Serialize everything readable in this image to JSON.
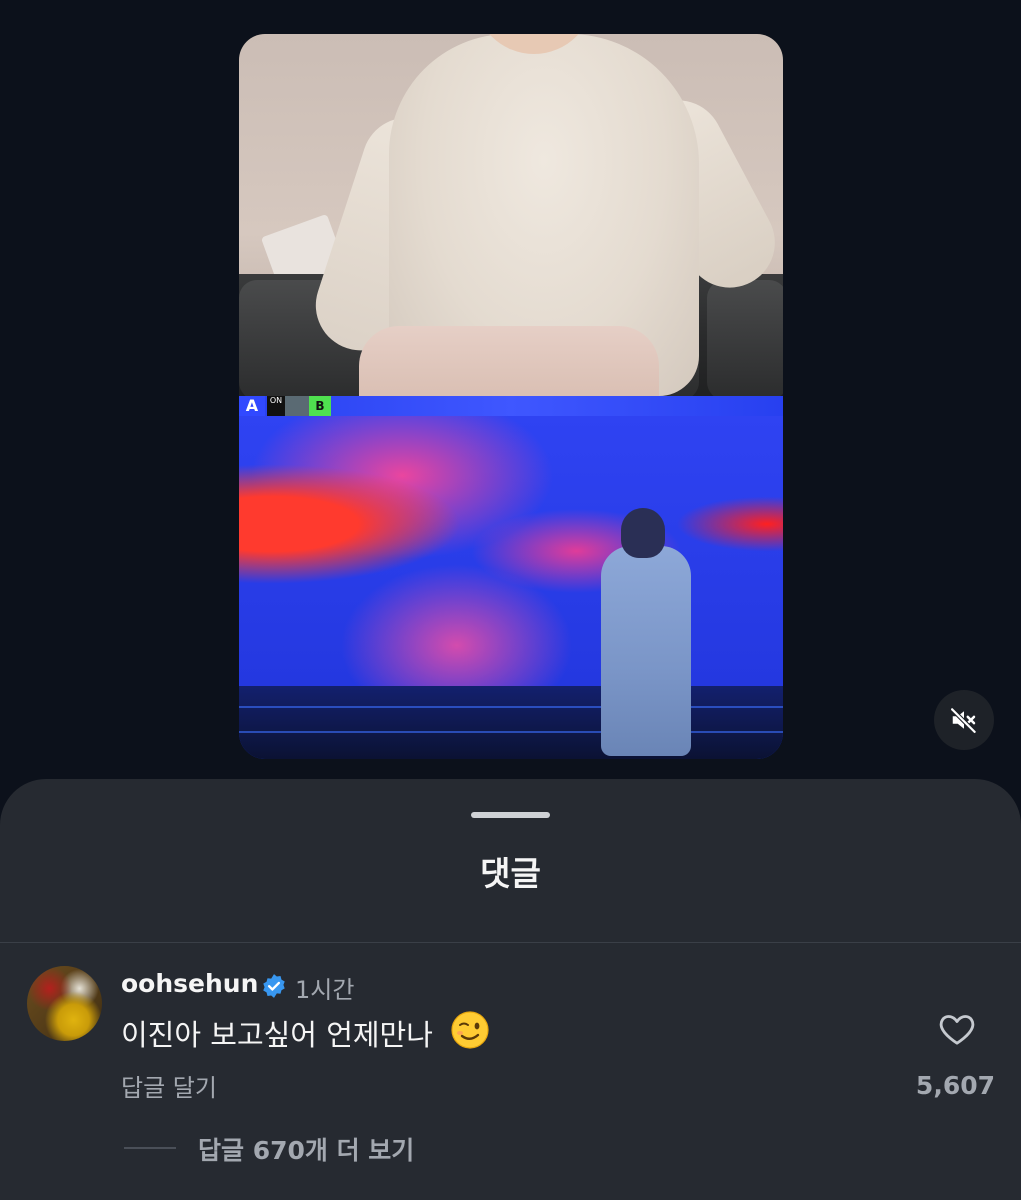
{
  "video": {
    "overlay": {
      "badge_a": "A",
      "badge_on": "ON",
      "badge_b": "B"
    },
    "mute_icon": "speaker-muted-icon"
  },
  "comments_sheet": {
    "title": "댓글",
    "comment": {
      "username": "oohsehun",
      "verified": true,
      "time": "1시간",
      "text": "이진아 보고싶어 언제만나",
      "emoji": "winking-face",
      "reply_label": "답글 달기",
      "likes": "5,607",
      "like_icon": "heart-outline-icon",
      "view_replies": "답글 670개 더 보기"
    }
  },
  "colors": {
    "background": "#0c111b",
    "sheet": "#262a31",
    "muted_text": "#a3a8b0",
    "verified_blue": "#3897f0"
  }
}
